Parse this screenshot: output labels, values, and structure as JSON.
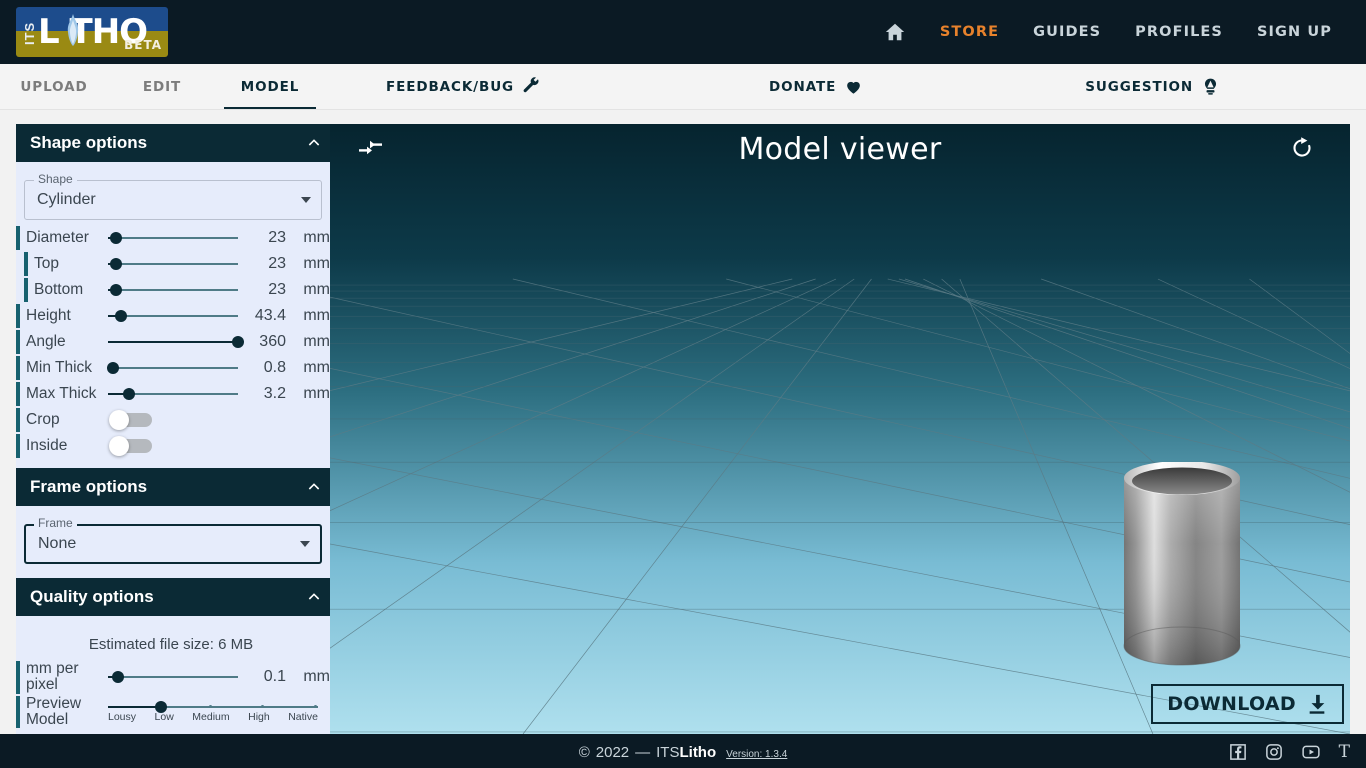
{
  "topnav": {
    "logo": {
      "its": "ITS",
      "word": "L THO",
      "beta": "BETA"
    },
    "home_icon": "home-icon",
    "links": [
      {
        "label": "STORE",
        "active": true
      },
      {
        "label": "GUIDES",
        "active": false
      },
      {
        "label": "PROFILES",
        "active": false
      },
      {
        "label": "SIGN UP",
        "active": false
      }
    ],
    "accent_color": "#e8822c"
  },
  "tabbar": {
    "tabs": [
      {
        "label": "UPLOAD",
        "active": false
      },
      {
        "label": "EDIT",
        "active": false
      },
      {
        "label": "MODEL",
        "active": true
      }
    ],
    "extras": [
      {
        "label": "FEEDBACK/BUG",
        "icon": "wrench-icon"
      },
      {
        "label": "DONATE",
        "icon": "heart-icon"
      },
      {
        "label": "SUGGESTION",
        "icon": "lightbulb-icon"
      }
    ]
  },
  "sidebar": {
    "shape_panel": {
      "title": "Shape options",
      "collapse_icon": "chevron-up-icon",
      "shape_select": {
        "legend": "Shape",
        "value": "Cylinder"
      },
      "rows": [
        {
          "label": "Diameter",
          "value": "23",
          "unit": "mm",
          "pct": 6,
          "indent": false,
          "type": "slider"
        },
        {
          "label": "Top",
          "value": "23",
          "unit": "mm",
          "pct": 6,
          "indent": true,
          "type": "slider"
        },
        {
          "label": "Bottom",
          "value": "23",
          "unit": "mm",
          "pct": 6,
          "indent": true,
          "type": "slider"
        },
        {
          "label": "Height",
          "value": "43.4",
          "unit": "mm",
          "pct": 10,
          "indent": false,
          "type": "slider"
        },
        {
          "label": "Angle",
          "value": "360",
          "unit": "mm",
          "pct": 100,
          "indent": false,
          "type": "slider"
        },
        {
          "label": "Min Thick",
          "value": "0.8",
          "unit": "mm",
          "pct": 4,
          "indent": false,
          "type": "slider"
        },
        {
          "label": "Max Thick",
          "value": "3.2",
          "unit": "mm",
          "pct": 16,
          "indent": false,
          "type": "slider"
        },
        {
          "label": "Crop",
          "value": "",
          "unit": "",
          "on": false,
          "indent": false,
          "type": "toggle"
        },
        {
          "label": "Inside",
          "value": "",
          "unit": "",
          "on": false,
          "indent": false,
          "type": "toggle"
        }
      ]
    },
    "frame_panel": {
      "title": "Frame options",
      "collapse_icon": "chevron-up-icon",
      "frame_select": {
        "legend": "Frame",
        "value": "None"
      }
    },
    "quality_panel": {
      "title": "Quality options",
      "collapse_icon": "chevron-up-icon",
      "estimated_size": "Estimated file size: 6 MB",
      "mm_per_pixel": {
        "label": "mm per pixel",
        "value": "0.1",
        "unit": "mm",
        "pct": 8
      },
      "preview_model": {
        "label": "Preview Model",
        "ticks": [
          "Lousy",
          "Low",
          "Medium",
          "High",
          "Native"
        ],
        "selected_index": 1
      }
    }
  },
  "viewer": {
    "title": "Model viewer",
    "collapse_icon": "compress-arrows-icon",
    "refresh_icon": "refresh-icon",
    "download_label": "DOWNLOAD",
    "download_icon": "download-icon"
  },
  "footer": {
    "copyright_symbol": "©",
    "year": "2022",
    "dash": "—",
    "brand_prefix": "ITS",
    "brand_bold": "Litho",
    "version": "Version: 1.3.4",
    "socials": [
      {
        "name": "facebook-icon"
      },
      {
        "name": "instagram-icon"
      },
      {
        "name": "youtube-icon"
      },
      {
        "name": "thingiverse-icon",
        "glyph": "T"
      }
    ]
  }
}
